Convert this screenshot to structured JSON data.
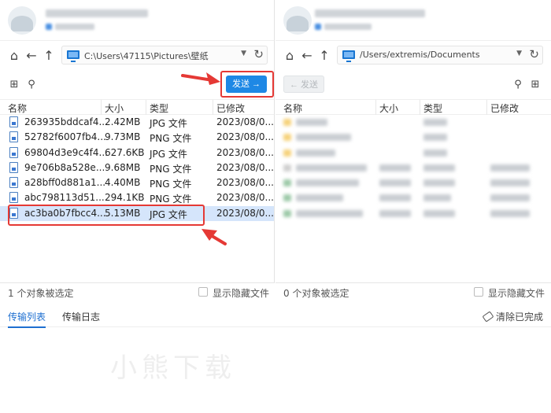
{
  "left": {
    "path": "C:\\Users\\47115\\Pictures\\壁纸",
    "send_label": "发送 →",
    "columns": [
      "名称",
      "大小",
      "类型",
      "已修改"
    ],
    "files": [
      {
        "name": "263935bddcaf4...",
        "size": "2.42MB",
        "type": "JPG 文件",
        "modified": "2023/08/0..."
      },
      {
        "name": "52782f6007fb4...",
        "size": "9.73MB",
        "type": "PNG 文件",
        "modified": "2023/08/0..."
      },
      {
        "name": "69804d3e9c4f4...",
        "size": "627.6KB",
        "type": "JPG 文件",
        "modified": "2023/08/0..."
      },
      {
        "name": "9e706b8a528e...",
        "size": "9.68MB",
        "type": "PNG 文件",
        "modified": "2023/08/0..."
      },
      {
        "name": "a28bff0d881a1...",
        "size": "4.40MB",
        "type": "PNG 文件",
        "modified": "2023/08/0..."
      },
      {
        "name": "abc798113d51...",
        "size": "294.1KB",
        "type": "PNG 文件",
        "modified": "2023/08/0..."
      },
      {
        "name": "ac3ba0b7fbcc4...",
        "size": "5.13MB",
        "type": "JPG 文件",
        "modified": "2023/08/0..."
      }
    ],
    "status": "1 个对象被选定",
    "show_hidden": "显示隐藏文件"
  },
  "right": {
    "path": "/Users/extremis/Documents",
    "send_label": "← 发送",
    "columns": [
      "名称",
      "大小",
      "类型",
      "已修改"
    ],
    "status": "0 个对象被选定",
    "show_hidden": "显示隐藏文件"
  },
  "tabs": [
    "传输列表",
    "传输日志"
  ],
  "clear_label": "清除已完成",
  "watermark": "小熊下载",
  "accent": "#1e88e5",
  "highlight": "#e53935"
}
